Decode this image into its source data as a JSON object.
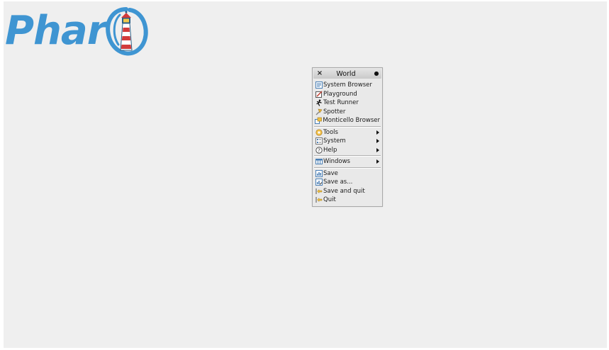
{
  "logo": {
    "text": "Phar"
  },
  "world_menu": {
    "title": "World",
    "close_glyph": "×",
    "pin_glyph": "●",
    "groups": [
      [
        {
          "label": "System Browser",
          "icon": "system-browser-icon",
          "has_submenu": false
        },
        {
          "label": "Playground",
          "icon": "playground-icon",
          "has_submenu": false
        },
        {
          "label": "Test Runner",
          "icon": "test-runner-icon",
          "has_submenu": false
        },
        {
          "label": "Spotter",
          "icon": "spotter-icon",
          "has_submenu": false
        },
        {
          "label": "Monticello Browser",
          "icon": "monticello-icon",
          "has_submenu": false
        }
      ],
      [
        {
          "label": "Tools",
          "icon": "tools-icon",
          "has_submenu": true
        },
        {
          "label": "System",
          "icon": "system-icon",
          "has_submenu": true
        },
        {
          "label": "Help",
          "icon": "help-icon",
          "has_submenu": true
        }
      ],
      [
        {
          "label": "Windows",
          "icon": "windows-icon",
          "has_submenu": true
        }
      ],
      [
        {
          "label": "Save",
          "icon": "save-icon",
          "has_submenu": false
        },
        {
          "label": "Save as...",
          "icon": "save-as-icon",
          "has_submenu": false
        },
        {
          "label": "Save and quit",
          "icon": "save-and-quit-icon",
          "has_submenu": false
        },
        {
          "label": "Quit",
          "icon": "quit-icon",
          "has_submenu": false
        }
      ]
    ]
  },
  "colors": {
    "world_background": "#efefef",
    "logo_blue": "#3f95d2",
    "menu_background": "#e9e9e9"
  }
}
